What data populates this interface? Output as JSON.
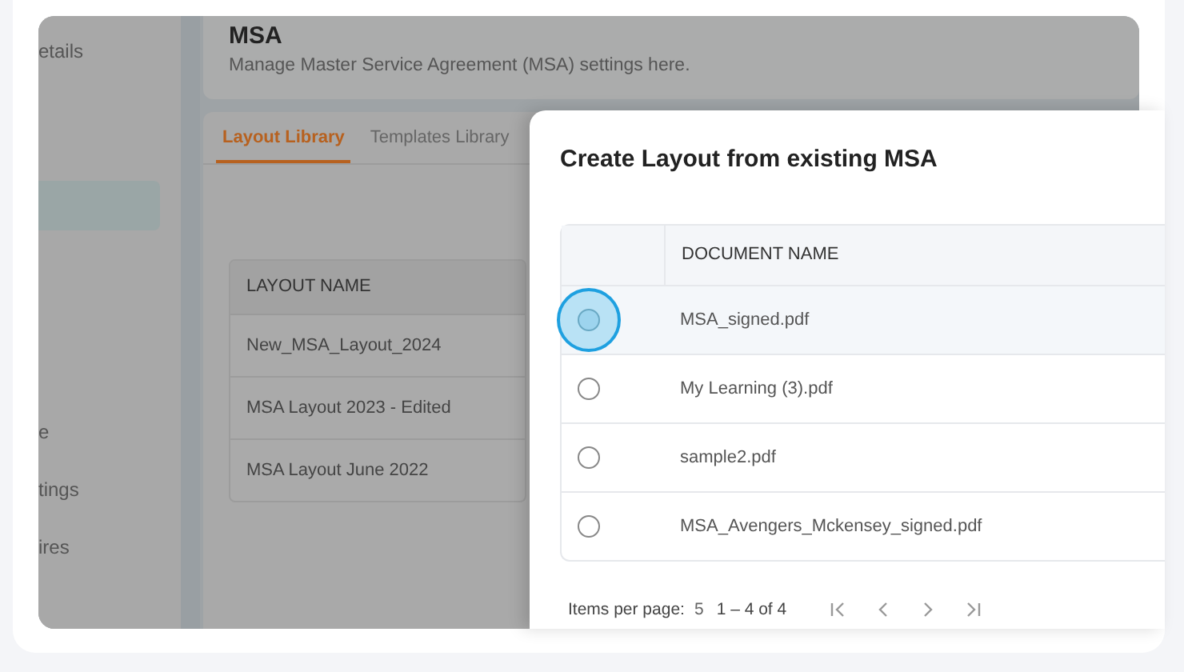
{
  "sidebar": {
    "items": [
      {
        "label": "etails"
      },
      {
        "label": "e"
      },
      {
        "label": "tings"
      },
      {
        "label": "ires"
      }
    ]
  },
  "header": {
    "title": "MSA",
    "subtitle": "Manage Master Service Agreement (MSA) settings here."
  },
  "tabs": [
    {
      "label": "Layout Library",
      "selected": true
    },
    {
      "label": "Templates Library",
      "selected": false
    }
  ],
  "layout_table": {
    "columns": [
      "LAYOUT NAME"
    ],
    "rows": [
      "New_MSA_Layout_2024",
      "MSA Layout 2023 - Edited",
      "MSA Layout June 2022"
    ]
  },
  "dialog": {
    "title": "Create Layout from existing MSA",
    "table": {
      "columns": [
        "DOCUMENT NAME"
      ],
      "rows": [
        {
          "name": "MSA_signed.pdf",
          "selected": true
        },
        {
          "name": "My Learning (3).pdf",
          "selected": false
        },
        {
          "name": "sample2.pdf",
          "selected": false
        },
        {
          "name": "MSA_Avengers_Mckensey_signed.pdf",
          "selected": false
        }
      ]
    },
    "paginator": {
      "items_per_page_label": "Items per page:",
      "items_per_page": "5",
      "range": "1 – 4 of 4"
    }
  }
}
